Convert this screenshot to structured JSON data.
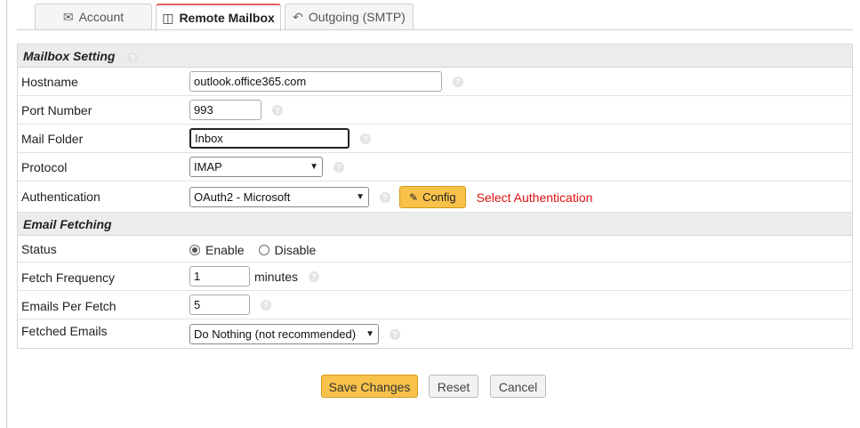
{
  "tabs": [
    {
      "label": "Account",
      "icon": "envelope-icon",
      "active": false
    },
    {
      "label": "Remote Mailbox",
      "icon": "inbox-icon",
      "active": true
    },
    {
      "label": "Outgoing (SMTP)",
      "icon": "reply-icon",
      "active": false
    }
  ],
  "mailbox": {
    "section_title": "Mailbox Setting",
    "hostname_label": "Hostname",
    "hostname_value": "outlook.office365.com",
    "port_label": "Port Number",
    "port_value": "993",
    "folder_label": "Mail Folder",
    "folder_value": "Inbox",
    "protocol_label": "Protocol",
    "protocol_value": "IMAP",
    "auth_label": "Authentication",
    "auth_value": "OAuth2 - Microsoft",
    "config_label": "Config",
    "auth_warning": "Select Authentication"
  },
  "fetching": {
    "section_title": "Email Fetching",
    "status_label": "Status",
    "enable_label": "Enable",
    "disable_label": "Disable",
    "status_selected": "Enable",
    "frequency_label": "Fetch Frequency",
    "frequency_value": "1",
    "frequency_unit": "minutes",
    "per_fetch_label": "Emails Per Fetch",
    "per_fetch_value": "5",
    "fetched_label": "Fetched Emails",
    "fetched_value": "Do Nothing (not recommended)"
  },
  "actions": {
    "save_label": "Save Changes",
    "reset_label": "Reset",
    "cancel_label": "Cancel"
  },
  "colors": {
    "accent": "#f8c24a",
    "warning": "#dd1111",
    "active_tab_border": "#e06060"
  }
}
